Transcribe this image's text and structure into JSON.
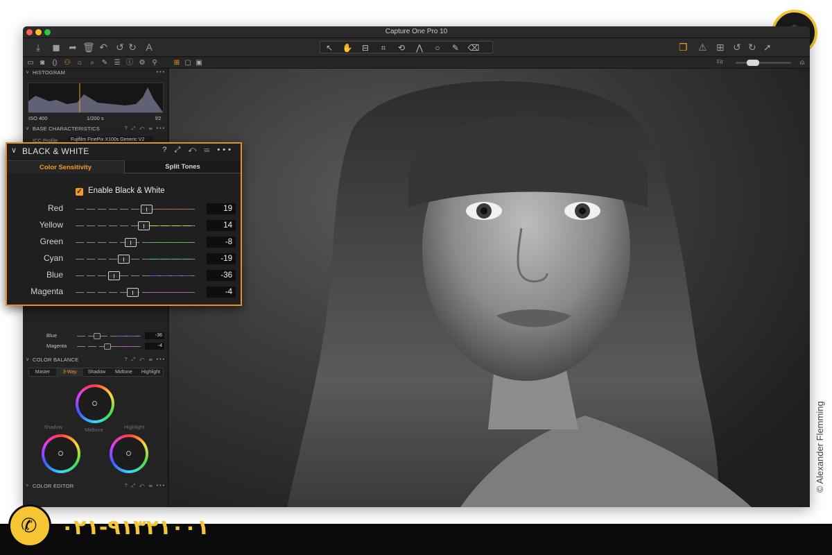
{
  "window": {
    "title": "Capture One Pro 10"
  },
  "toolbar": {
    "left_icons": [
      "import-icon",
      "camera-icon",
      "move-to-icon",
      "trash-icon",
      "reset-icon",
      "undo-icon",
      "redo-icon",
      "text-icon"
    ],
    "tools": [
      "select-tool",
      "pan-tool",
      "loupe-tool",
      "crop-tool",
      "rotate-tool",
      "keystone-tool",
      "spot-tool",
      "brush-tool",
      "eraser-tool",
      "picker-tool"
    ],
    "right_icons": [
      "stack-icon",
      "warning-icon",
      "grid-icon",
      "rotate-left-icon",
      "rotate-right-icon",
      "cursor-icon"
    ]
  },
  "subbar": {
    "fit_label": "Fit",
    "zoom_level": 0.2
  },
  "panels": {
    "histogram": {
      "title": "HISTOGRAM",
      "iso": "ISO 400",
      "shutter": "1/200 s",
      "aperture": "f/2"
    },
    "base": {
      "title": "BASE CHARACTERISTICS",
      "icc_label": "ICC Profile",
      "icc_value": "Fujifilm FinePix X100s Generic V2"
    },
    "mini_sliders": [
      {
        "label": "Blue",
        "value": "-36",
        "pos": 0.32,
        "color": "#5b6de0"
      },
      {
        "label": "Magenta",
        "value": "-4",
        "pos": 0.48,
        "color": "#c54ec8"
      }
    ],
    "color_balance": {
      "title": "COLOR BALANCE",
      "tabs": [
        "Master",
        "3-Way",
        "Shadow",
        "Midtone",
        "Highlight"
      ],
      "active_tab": "3-Way",
      "wheel_labels": {
        "shadow": "Shadow",
        "midtone": "Midtone",
        "highlight": "Highlight"
      }
    },
    "color_editor": {
      "title": "COLOR EDITOR"
    }
  },
  "bw": {
    "title": "BLACK & WHITE",
    "tabs": {
      "color_sensitivity": "Color Sensitivity",
      "split_tones": "Split Tones"
    },
    "enable_label": "Enable Black & White",
    "enabled": true,
    "sliders": [
      {
        "label": "Red",
        "value": "19",
        "pos": 0.595,
        "color": "#e0533f"
      },
      {
        "label": "Yellow",
        "value": "14",
        "pos": 0.57,
        "color": "#e8d248"
      },
      {
        "label": "Green",
        "value": "-8",
        "pos": 0.46,
        "color": "#53c653"
      },
      {
        "label": "Cyan",
        "value": "-19",
        "pos": 0.405,
        "color": "#3fc7d6"
      },
      {
        "label": "Blue",
        "value": "-36",
        "pos": 0.32,
        "color": "#4e66e6"
      },
      {
        "label": "Magenta",
        "value": "-4",
        "pos": 0.48,
        "color": "#c94fd0"
      }
    ]
  },
  "overlay": {
    "copyright": "© Alexander Flemming",
    "phone": "۰۲۱-۹۱۳۲۱۰۰۱"
  },
  "colors": {
    "accent": "#f29a28",
    "brand_yellow": "#f6c533"
  }
}
